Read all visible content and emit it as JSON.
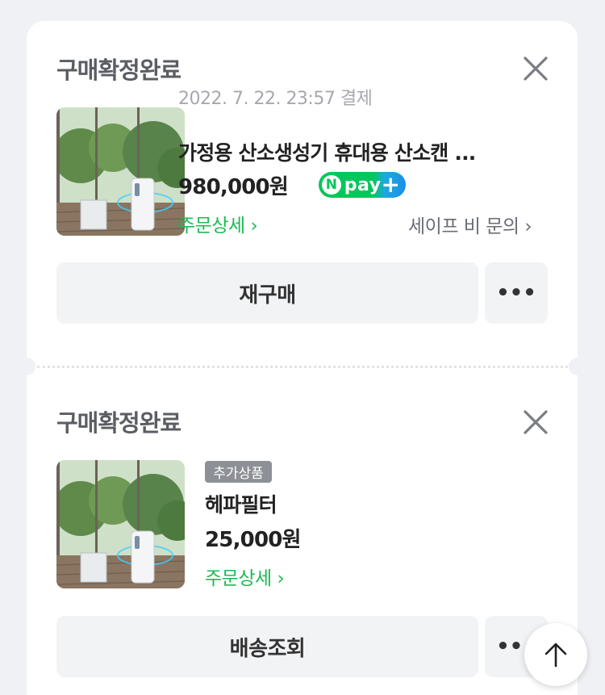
{
  "orders": [
    {
      "status": "구매확정완료",
      "date": "2022. 7. 22. 23:57 결제",
      "product_name": "가정용 산소생성기 휴대용 산소캔 ...",
      "price": "980,000원",
      "npay_label": "pay",
      "detail_link": "주문상세",
      "inquiry_link": "세이프 비 문의",
      "primary_button": "재구매",
      "more_button": "•••"
    },
    {
      "status": "구매확정완료",
      "badge": "추가상품",
      "product_name": "헤파필터",
      "price": "25,000원",
      "detail_link": "주문상세",
      "primary_button": "배송조회",
      "more_button": "•••"
    }
  ],
  "colors": {
    "background": "#f0f1f4",
    "accent_green": "#1db954",
    "npay_green": "#03c75a",
    "npay_blue": "#1a8ee8",
    "button_bg": "#f2f3f5"
  },
  "icons": {
    "close": "close-icon",
    "chevron": "chevron-right-icon",
    "scroll_top": "arrow-up-icon"
  }
}
